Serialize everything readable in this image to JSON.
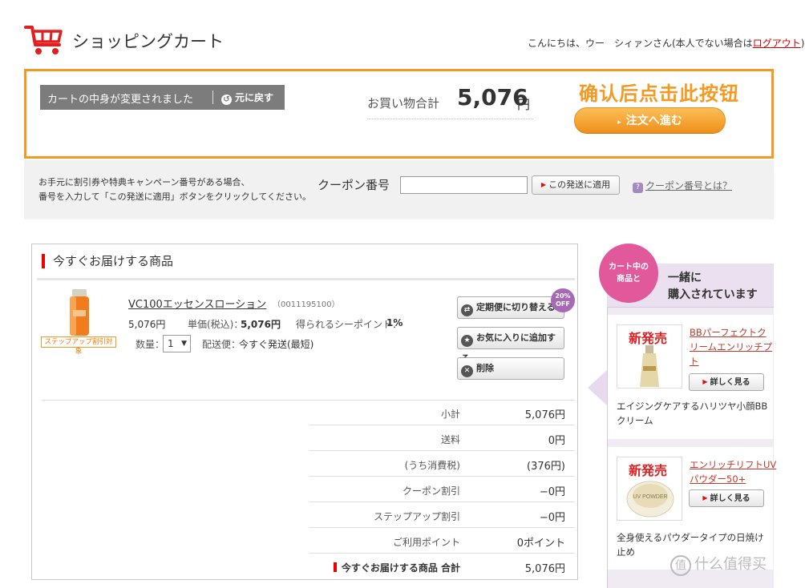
{
  "header": {
    "title": "ショッピングカート",
    "greeting_prefix": "こんにちは、ウー　シィァンさん(本人でない場合は",
    "logout_label": "ログアウト",
    "greeting_suffix": ")"
  },
  "summary": {
    "change_message": "カートの中身が変更されました",
    "undo_label": "元に戻す",
    "total_label": "お買い物合計",
    "total_value": "5,076",
    "total_unit": "円",
    "annotation": "确认后点击此按钮",
    "order_button": "注文へ進む"
  },
  "coupon": {
    "help_line1": "お手元に割引券や特典キャンペーン番号がある場合、",
    "help_line2": "番号を入力して「この発送に適用」ボタンをクリックしてください。",
    "label": "クーポン番号",
    "input_value": "",
    "apply_button": "この発送に適用",
    "info_link": "クーポン番号とは？"
  },
  "main": {
    "section_title": "今すぐお届けする商品",
    "product": {
      "step_badge": "ステップアップ割引対象",
      "name": "VC100エッセンスローション",
      "code": "（0011195100）",
      "price": "5,076円",
      "unit_price_label": "単価(税込)：",
      "unit_price": "5,076円",
      "points_label": "得られるシーポイント：",
      "points": "1%",
      "qty_label": "数量：",
      "qty_value": "1",
      "shipping_label": "配送便：",
      "shipping_value": "今すぐ発送(最短)"
    },
    "actions": {
      "subscribe": "定期便に切り替える",
      "favorite": "お気に入りに追加する",
      "delete": "削除",
      "off_badge_line1": "20%",
      "off_badge_line2": "OFF"
    },
    "summary_rows": [
      {
        "label": "小計",
        "value": "5,076円"
      },
      {
        "label": "送料",
        "value": "0円"
      },
      {
        "label": "(うち消費税)",
        "value": "(376円)"
      },
      {
        "label": "クーポン割引",
        "value": "−0円"
      },
      {
        "label": "ステップアップ割引",
        "value": "−0円"
      },
      {
        "label": "ご利用ポイント",
        "value": "0ポイント"
      },
      {
        "label": "今すぐお届けする商品 合計",
        "value": "5,076円"
      }
    ]
  },
  "side": {
    "circle_line1": "カート中の",
    "circle_line2": "商品と",
    "title_line1": "一緒に",
    "title_line2": "購入されています",
    "items": [
      {
        "new_label": "新発売",
        "link_line1": "BBパーフェクトク",
        "link_line2": "リームエンリッチプ",
        "link_line3": "ト",
        "detail_button": "詳しく見る",
        "desc_line1": "エイジングケアするハリツヤ小顔BB",
        "desc_line2": "クリーム"
      },
      {
        "new_label": "新発売",
        "link_line1": "エンリッチリフトUV",
        "link_line2": "パウダー50+",
        "detail_button": "詳しく見る",
        "desc_line1": "全身使えるパウダータイプの日焼け",
        "desc_line2": "止め",
        "img_text": "UV POWDER"
      }
    ]
  },
  "watermark": "什么值得买"
}
